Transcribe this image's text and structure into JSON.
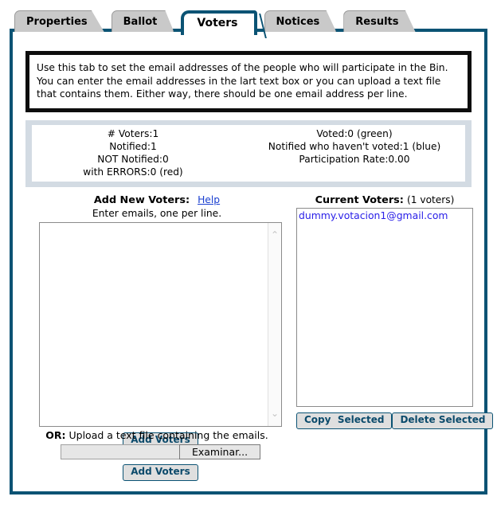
{
  "tabs": [
    {
      "label": "Properties",
      "active": false
    },
    {
      "label": "Ballot",
      "active": false
    },
    {
      "label": "Voters",
      "active": true
    },
    {
      "label": "Notices",
      "active": false
    },
    {
      "label": "Results",
      "active": false
    }
  ],
  "instructions": {
    "text": "Use this tab to set the email addresses of the people who will participate in the Bin. You can enter the email addresses in the lart text box or you can upload a text file that contains them. Either way, there should be one email address per line."
  },
  "stats": {
    "rows": [
      {
        "left": "# Voters:1",
        "right": "Voted:0 (green)"
      },
      {
        "left": "Notified:1",
        "right": "Notified who haven't voted:1 (blue)"
      },
      {
        "left": "NOT Notified:0",
        "right": "Participation Rate:0.00"
      },
      {
        "left": "with ERRORS:0 (red)",
        "right": ""
      }
    ]
  },
  "add_voters": {
    "title": "Add New Voters:",
    "help_label": "Help",
    "subtitle": "Enter emails, one per line.",
    "textarea_value": "",
    "textarea_placeholder": "",
    "add_button_label": "Add Voters"
  },
  "current_voters": {
    "title": "Current Voters:",
    "count_label": "(1 voters)",
    "entries": [
      "dummy.votacion1@gmail.com"
    ],
    "copy_button_label": "Copy  Selected",
    "delete_button_label": "Delete Selected"
  },
  "upload": {
    "or_label": "OR:",
    "description": " Upload a text file containing the emails.",
    "file_value": "",
    "browse_button_label": "Examinar...",
    "add_button_label": "Add Voters"
  },
  "icons": {
    "scroll_up": "⌃",
    "scroll_down": "⌄"
  },
  "colors": {
    "frame_border": "#0b5374",
    "tab_inactive_bg": "#c9c9c9",
    "stats_panel_bg": "#d3dbe3",
    "voter_entry": "#2a20e8",
    "link": "#1a3fd0",
    "button_text": "#0b4a6b"
  }
}
